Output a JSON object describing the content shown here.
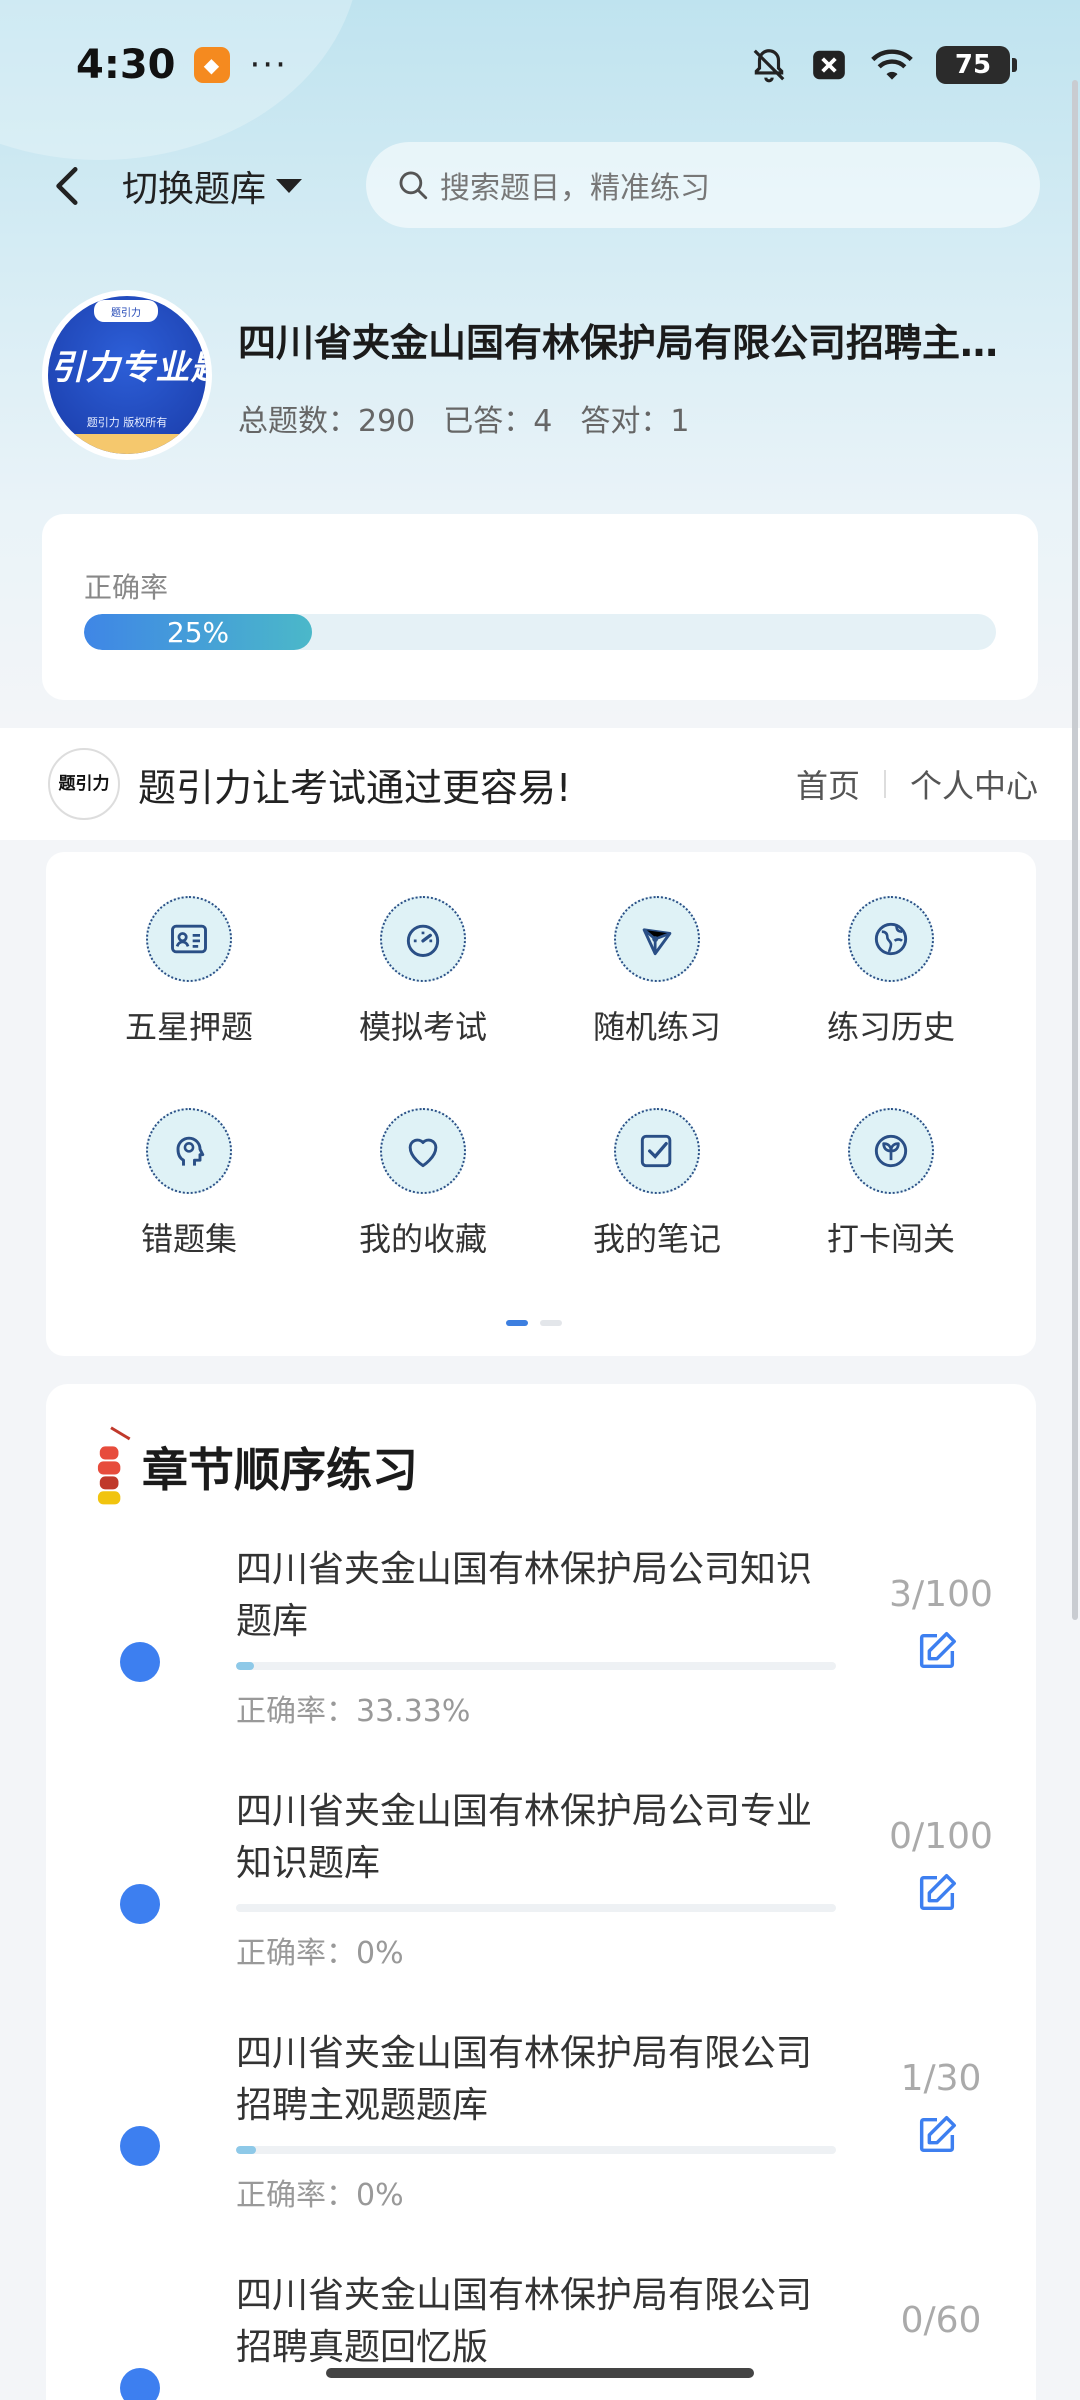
{
  "status_bar": {
    "time": "4:30",
    "more": "···",
    "battery": "75"
  },
  "topbar": {
    "switch_label": "切换题库",
    "search_placeholder": "搜索题目，精准练习"
  },
  "bank": {
    "logo_main": "引力专业题",
    "logo_sub": "题引力 版权所有",
    "logo_tag": "题引力",
    "title": "四川省夹金山国有林保护局有限公司招聘主观题题库",
    "stats": {
      "total_label": "总题数：",
      "total": "290",
      "answered_label": "已答：",
      "answered": "4",
      "correct_label": "答对：",
      "correct": "1"
    }
  },
  "accuracy": {
    "label": "正确率",
    "value_text": "25%",
    "value": 0.25
  },
  "brand": {
    "logo_text": "题引力",
    "slogan": "题引力让考试通过更容易!",
    "link_home": "首页",
    "link_personal": "个人中心"
  },
  "features": [
    {
      "label": "五星押题",
      "icon": "id-card-icon"
    },
    {
      "label": "模拟考试",
      "icon": "speedometer-icon"
    },
    {
      "label": "随机练习",
      "icon": "network-icon"
    },
    {
      "label": "练习历史",
      "icon": "globe-icon"
    },
    {
      "label": "错题集",
      "icon": "head-icon"
    },
    {
      "label": "我的收藏",
      "icon": "heart-icon"
    },
    {
      "label": "我的笔记",
      "icon": "note-check-icon"
    },
    {
      "label": "打卡闯关",
      "icon": "sprout-icon"
    }
  ],
  "chapters": {
    "title": "章节顺序练习",
    "items": [
      {
        "name": "四川省夹金山国有林保护局公司知识题库",
        "count": "3/100",
        "rate": "正确率：33.33%",
        "progress": 0.03
      },
      {
        "name": "四川省夹金山国有林保护局公司专业知识题库",
        "count": "0/100",
        "rate": "正确率：0%",
        "progress": 0
      },
      {
        "name": "四川省夹金山国有林保护局有限公司招聘主观题题库",
        "count": "1/30",
        "rate": "正确率：0%",
        "progress": 0.033
      },
      {
        "name": "四川省夹金山国有林保护局有限公司招聘真题回忆版",
        "count": "0/60",
        "rate": "",
        "progress": 0
      }
    ]
  },
  "colors": {
    "accent": "#3d7ff0",
    "progress_start": "#3f86e6",
    "progress_end": "#4bb8c9",
    "icon_stroke": "#2a4f86"
  }
}
